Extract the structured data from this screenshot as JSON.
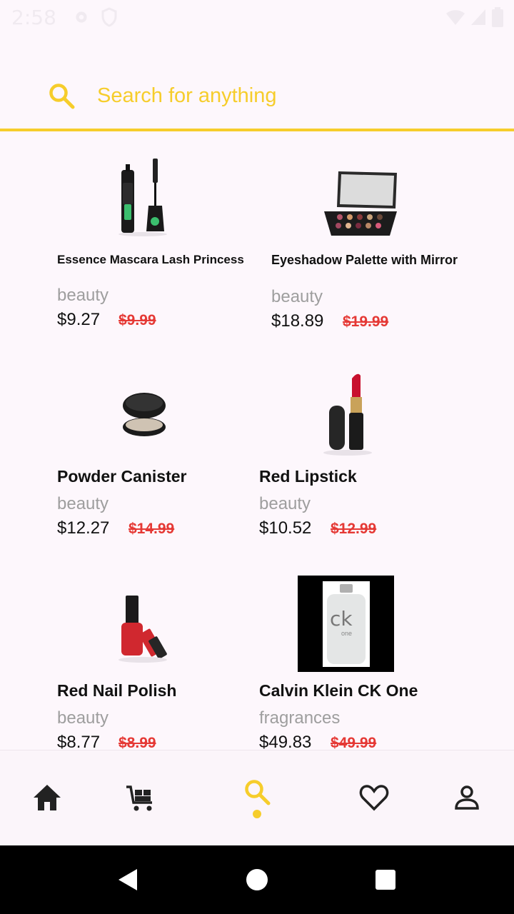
{
  "status_bar": {
    "time": "2:58"
  },
  "search": {
    "placeholder": "Search for anything"
  },
  "products": [
    {
      "name": "Essence Mascara Lash Princess",
      "category": "beauty",
      "price": "$9.27",
      "original_price": "$9.99"
    },
    {
      "name": "Eyeshadow Palette with Mirror",
      "category": "beauty",
      "price": "$18.89",
      "original_price": "$19.99"
    },
    {
      "name": "Powder Canister",
      "category": "beauty",
      "price": "$12.27",
      "original_price": "$14.99"
    },
    {
      "name": "Red Lipstick",
      "category": "beauty",
      "price": "$10.52",
      "original_price": "$12.99"
    },
    {
      "name": "Red Nail Polish",
      "category": "beauty",
      "price": "$8.77",
      "original_price": "$8.99"
    },
    {
      "name": "Calvin Klein CK One",
      "category": "fragrances",
      "price": "$49.83",
      "original_price": "$49.99"
    }
  ],
  "perfume_label": {
    "brand": "ck",
    "line": "one"
  },
  "bottom_nav": {
    "items": [
      {
        "icon": "home-icon"
      },
      {
        "icon": "cart-icon"
      },
      {
        "icon": "search-icon",
        "active": true
      },
      {
        "icon": "heart-icon"
      },
      {
        "icon": "profile-icon"
      }
    ]
  },
  "colors": {
    "accent": "#f6cd2b",
    "sale": "#e53935",
    "category": "#9e9e9e",
    "background": "#fdf7fc"
  }
}
